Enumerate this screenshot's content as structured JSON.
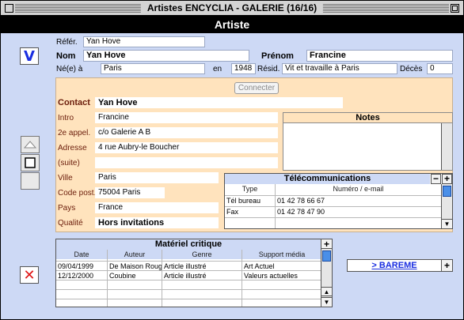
{
  "window": {
    "title": "Artistes ENCYCLIA - GALERIE (16/16)"
  },
  "form": {
    "title": "Artiste"
  },
  "header": {
    "refer_label": "Référ.",
    "refer_value": "Yan Hove",
    "nom_label": "Nom",
    "nom_value": "Yan Hove",
    "prenom_label": "Prénom",
    "prenom_value": "Francine",
    "ne_label": "Né(e) à",
    "ne_value": "Paris",
    "en_label": "en",
    "en_value": "1948",
    "resid_label": "Résid.",
    "resid_value": "Vit et travaille à Paris",
    "deces_label": "Décès",
    "deces_value": "0"
  },
  "contact": {
    "connect_button": "Connecter",
    "contact_label": "Contact",
    "contact_value": "Yan Hove",
    "intro_label": "Intro",
    "intro_value": "Francine",
    "appel2_label": "2e appel.",
    "appel2_value": "c/o Galerie A B",
    "adresse_label": "Adresse",
    "adresse_value": "4 rue Aubry-le Boucher",
    "suite_label": "(suite)",
    "suite_value": "",
    "ville_label": "Ville",
    "ville_value": "Paris",
    "cp_label": "Code post.",
    "cp_value": "75004 Paris",
    "pays_label": "Pays",
    "pays_value": "France",
    "qualite_label": "Qualité",
    "qualite_value": "Hors invitations",
    "notes_title": "Notes"
  },
  "telecom": {
    "title": "Télécommunications",
    "col_type": "Type",
    "col_num": "Numéro / e-mail",
    "rows": [
      {
        "type": "Tél bureau",
        "num": "01 42 78 66 67"
      },
      {
        "type": "Fax",
        "num": "01 42 78 47 90"
      },
      {
        "type": "",
        "num": ""
      }
    ],
    "minus": "−",
    "plus": "+"
  },
  "critique": {
    "title": "Matériel critique",
    "columns": [
      "Date",
      "Auteur",
      "Genre",
      "Support média"
    ],
    "rows": [
      [
        "09/04/1999",
        "De Maison Rouge",
        "Article illustré",
        "Art Actuel"
      ],
      [
        "12/12/2000",
        "Coubine",
        "Article illustré",
        "Valeurs actuelles"
      ],
      [
        "",
        "",
        "",
        ""
      ],
      [
        "",
        "",
        "",
        ""
      ],
      [
        "",
        "",
        "",
        ""
      ]
    ],
    "plus": "+"
  },
  "bareme": {
    "label": "> BAREME",
    "plus": "+"
  },
  "sidebar": {
    "validate_glyph": "V",
    "cancel_glyph": "✕"
  },
  "colors": {
    "panel_blue": "#cdd9f5",
    "panel_orange": "#ffe3bd",
    "accent_blue": "#1a2ee0",
    "accent_red": "#e01818"
  }
}
